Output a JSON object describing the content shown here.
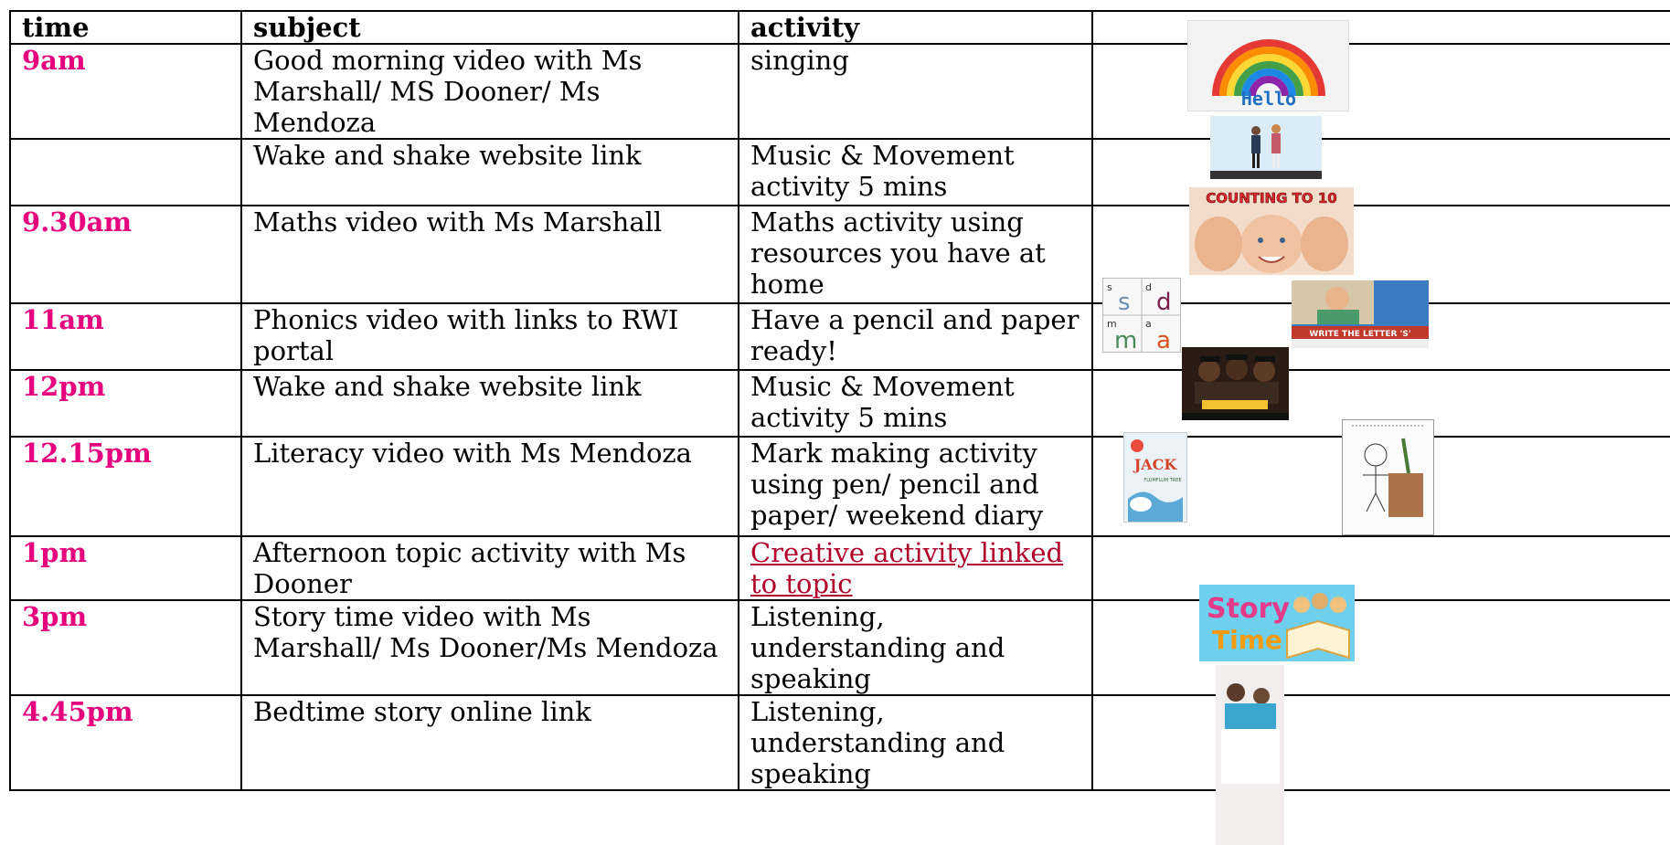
{
  "headers": {
    "time": "time",
    "subject": "subject",
    "activity": "activity"
  },
  "rows": [
    {
      "time": "9am",
      "subject": "Good morning video with Ms Marshall/ MS Dooner/ Ms Mendoza",
      "activity": "singing"
    },
    {
      "time": "",
      "subject": "Wake and shake website link",
      "activity": "Music & Movement activity 5 mins"
    },
    {
      "time": "9.30am",
      "subject": "Maths video with Ms Marshall",
      "activity": "Maths activity using resources you have at home"
    },
    {
      "time": "11am",
      "subject": "Phonics video with links to RWI portal",
      "activity": "Have a pencil and paper ready!"
    },
    {
      "time": "12pm",
      "subject": "Wake and shake website link",
      "activity": "Music & Movement activity 5 mins"
    },
    {
      "time": "12.15pm",
      "subject": "Literacy video with Ms Mendoza",
      "activity": "Mark making activity using pen/ pencil and paper/ weekend diary"
    },
    {
      "time": "1pm",
      "subject": "Afternoon topic activity with Ms Dooner",
      "activity": "Creative activity linked to topic"
    },
    {
      "time": "3pm",
      "subject": "Story time video with Ms Marshall/ Ms Dooner/Ms Mendoza",
      "activity": "Listening, understanding and speaking"
    },
    {
      "time": "4.45pm",
      "subject": "Bedtime story online link",
      "activity": "Listening, understanding and speaking"
    }
  ],
  "images": {
    "rainbow_text": "Hello",
    "counting_text": "COUNTING TO 10",
    "letters": [
      "s",
      "d",
      "m",
      "a"
    ],
    "write_caption": "WRITE THE LETTER 'S'",
    "jack_title": "JACK",
    "jack_subtitle": "FLUMFLUM TREE",
    "story_word1": "Story",
    "story_word2": "Time"
  },
  "colors": {
    "time_text": "#e6007e",
    "link": "#b0002a",
    "border": "#000000"
  }
}
